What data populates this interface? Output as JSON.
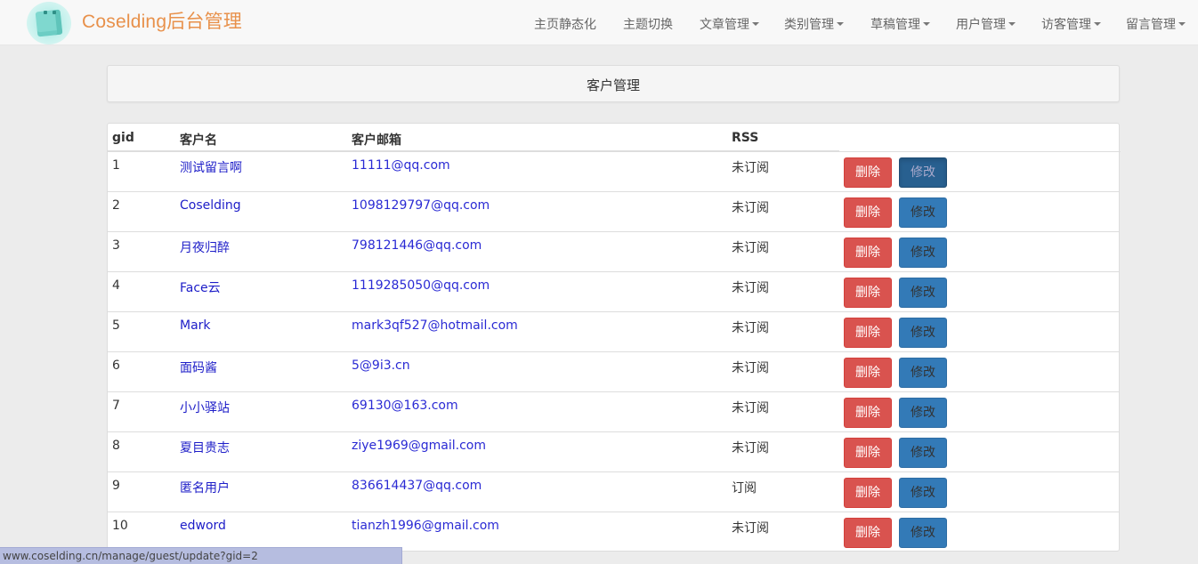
{
  "brand": {
    "title": "Coselding后台管理",
    "logo_icon": "cube-mascot-icon"
  },
  "nav": {
    "items": [
      {
        "label": "主页静态化",
        "dropdown": false
      },
      {
        "label": "主题切换",
        "dropdown": false
      },
      {
        "label": "文章管理",
        "dropdown": true
      },
      {
        "label": "类别管理",
        "dropdown": true
      },
      {
        "label": "草稿管理",
        "dropdown": true
      },
      {
        "label": "用户管理",
        "dropdown": true
      },
      {
        "label": "访客管理",
        "dropdown": true
      },
      {
        "label": "留言管理",
        "dropdown": true
      }
    ]
  },
  "page": {
    "title": "客户管理"
  },
  "table": {
    "headers": {
      "gid": "gid",
      "name": "客户名",
      "email": "客户邮箱",
      "rss": "RSS"
    },
    "delete_label": "删除",
    "edit_label": "修改",
    "rows": [
      {
        "gid": "1",
        "name": "测试留言啊",
        "email": "11111@qq.com",
        "rss": "未订阅"
      },
      {
        "gid": "2",
        "name": "Coselding",
        "email": "1098129797@qq.com",
        "rss": "未订阅"
      },
      {
        "gid": "3",
        "name": "月夜归醉",
        "email": "798121446@qq.com",
        "rss": "未订阅"
      },
      {
        "gid": "4",
        "name": "Face云",
        "email": "1119285050@qq.com",
        "rss": "未订阅"
      },
      {
        "gid": "5",
        "name": "Mark",
        "email": "mark3qf527@hotmail.com",
        "rss": "未订阅"
      },
      {
        "gid": "6",
        "name": "面码酱",
        "email": "5@9i3.cn",
        "rss": "未订阅"
      },
      {
        "gid": "7",
        "name": "小小驿站",
        "email": "69130@163.com",
        "rss": "未订阅"
      },
      {
        "gid": "8",
        "name": "夏目贵志",
        "email": "ziye1969@gmail.com",
        "rss": "未订阅"
      },
      {
        "gid": "9",
        "name": "匿名用户",
        "email": "836614437@qq.com",
        "rss": "订阅"
      },
      {
        "gid": "10",
        "name": "edword",
        "email": "tianzh1996@gmail.com",
        "rss": "未订阅"
      }
    ]
  },
  "status_bar": {
    "url": "www.coselding.cn/manage/guest/update?gid=2"
  },
  "colors": {
    "brand": "#e8914b",
    "danger": "#d9534f",
    "primary": "#337ab7",
    "link": "#1d1dc8"
  }
}
